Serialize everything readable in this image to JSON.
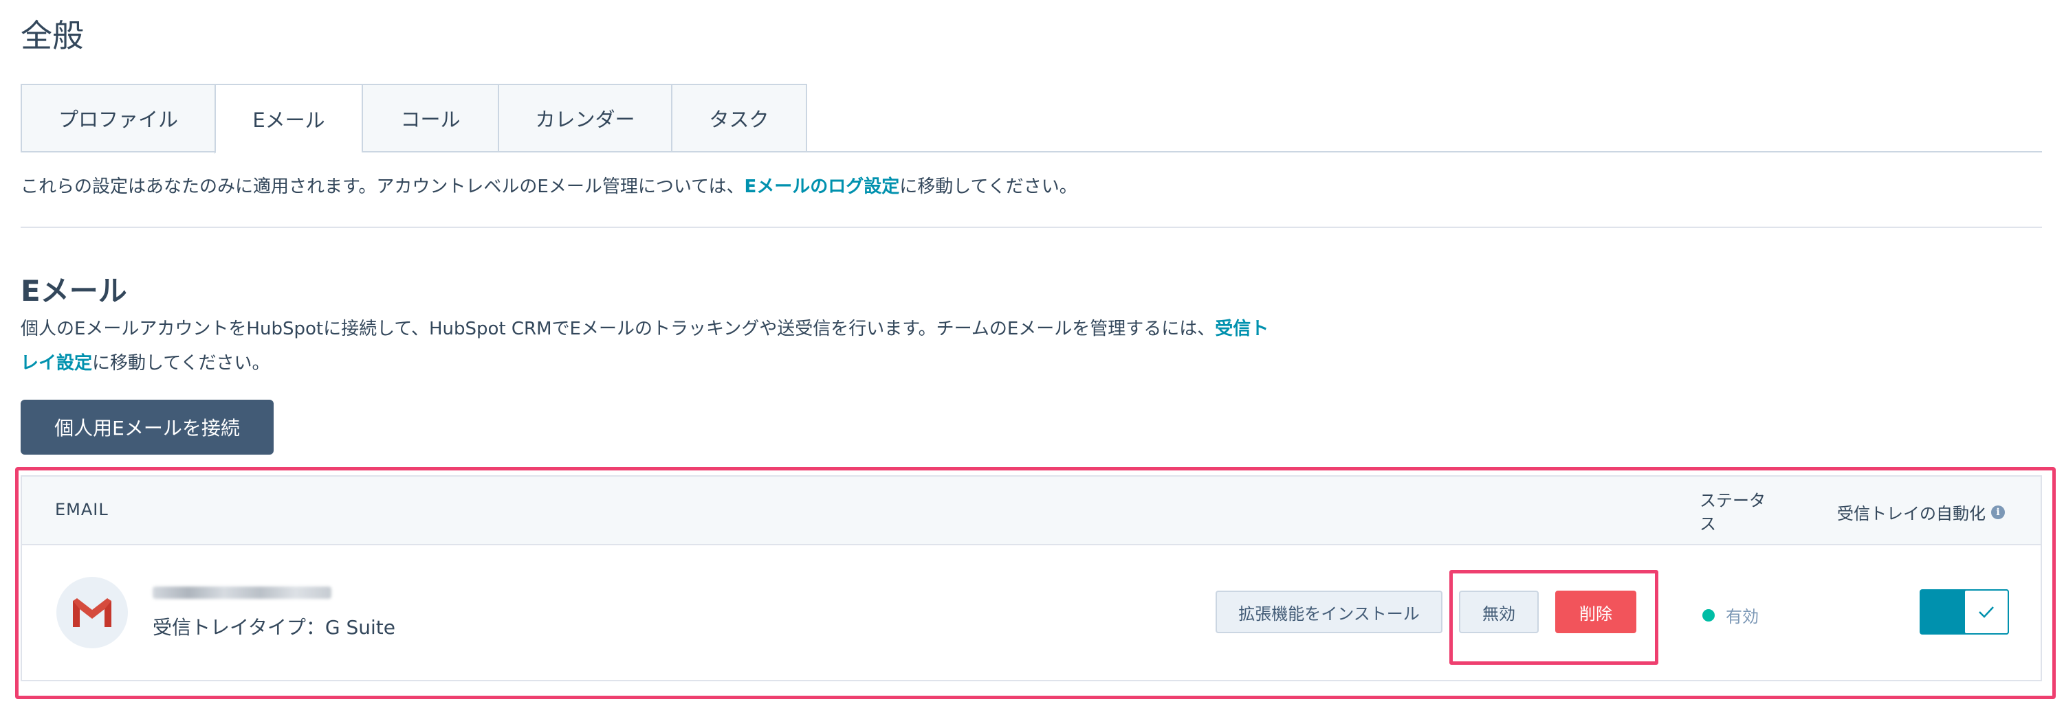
{
  "page": {
    "title": "全般"
  },
  "tabs": [
    {
      "label": "プロファイル",
      "active": false
    },
    {
      "label": "Eメール",
      "active": true
    },
    {
      "label": "コール",
      "active": false
    },
    {
      "label": "カレンダー",
      "active": false
    },
    {
      "label": "タスク",
      "active": false
    }
  ],
  "notice": {
    "prefix": "これらの設定はあなたのみに適用されます。アカウントレベルのEメール管理については、",
    "link": "Eメールのログ設定",
    "suffix": "に移動してください。"
  },
  "email_section": {
    "title": "Eメール",
    "desc_prefix": "個人のEメールアカウントをHubSpotに接続して、HubSpot CRMでEメールのトラッキングや送受信を行います。チームのEメールを管理するには、",
    "desc_link": "受信トレイ設定",
    "desc_suffix": "に移動してください。",
    "connect_button": "個人用Eメールを接続"
  },
  "table": {
    "headers": {
      "email": "EMAIL",
      "status": "ステータス",
      "automation": "受信トレイの自動化"
    },
    "rows": [
      {
        "inbox_type": "受信トレイタイプ：G Suite",
        "install_button": "拡張機能をインストール",
        "disable_button": "無効",
        "delete_button": "削除",
        "status": "有効",
        "automation_enabled": true
      }
    ]
  },
  "colors": {
    "primary_text": "#33475b",
    "link": "#0091ae",
    "highlight": "#ee3f6f",
    "delete": "#f2545b",
    "status_active": "#00bda5",
    "toggle_on": "#0091ae"
  },
  "icons": {
    "gmail": "gmail-logo-icon",
    "info": "info-icon",
    "check": "check-icon"
  }
}
